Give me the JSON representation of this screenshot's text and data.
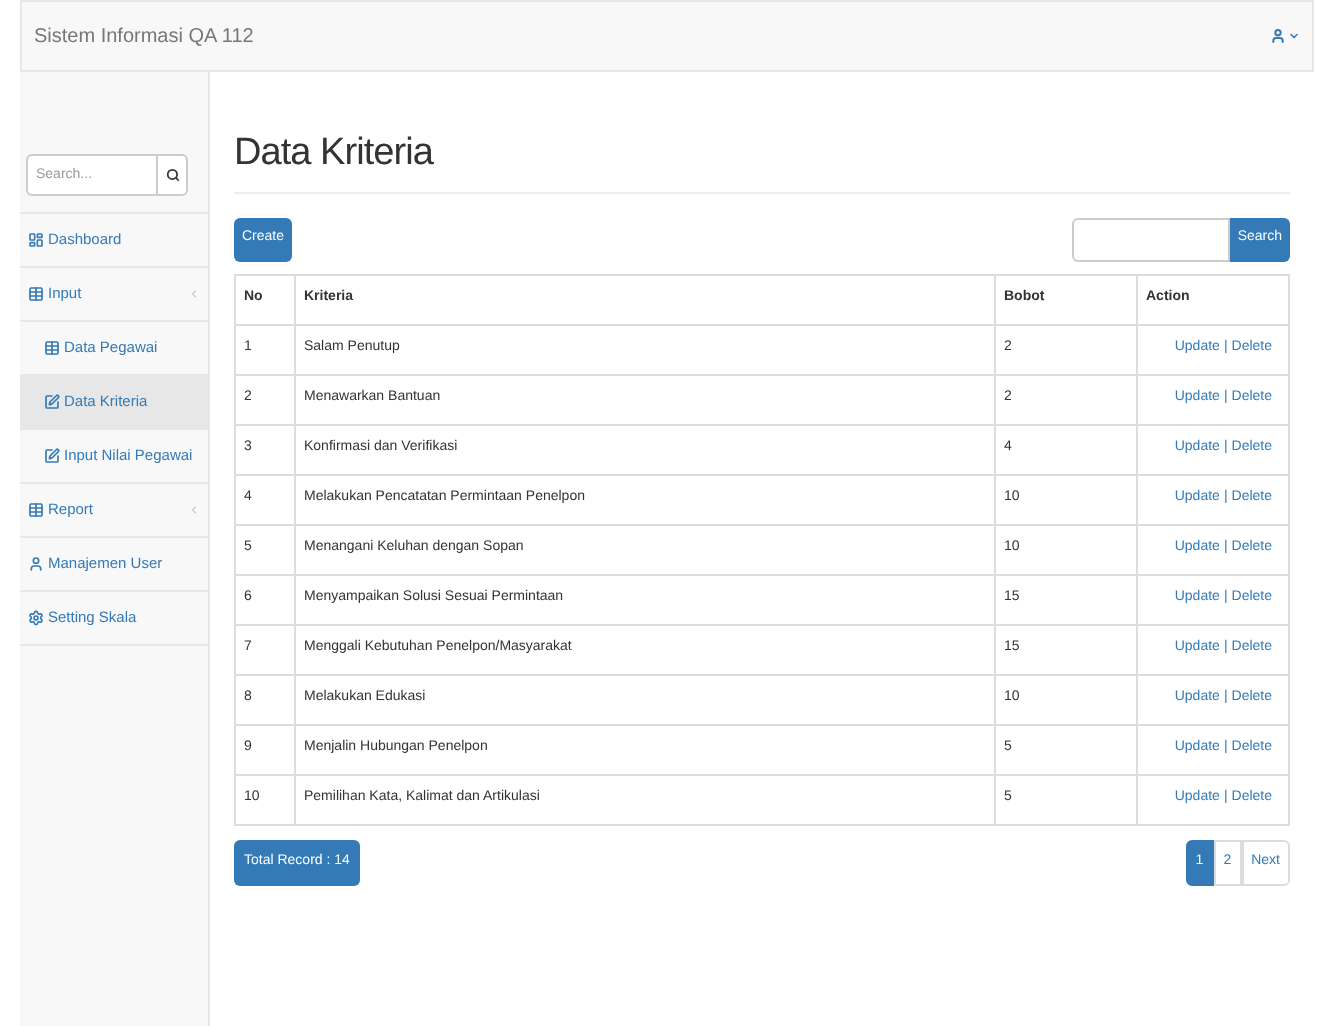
{
  "navbar": {
    "brand": "Sistem Informasi QA 112"
  },
  "sidebar": {
    "search": {
      "placeholder": "Search..."
    },
    "items": [
      {
        "label": "Dashboard",
        "kind": "dashboard",
        "selected": false,
        "submenu": false
      },
      {
        "label": "Input",
        "kind": "table",
        "selected": false,
        "submenu": true,
        "children": [
          {
            "label": "Data Pegawai",
            "kind": "table",
            "selected": false
          },
          {
            "label": "Data Kriteria",
            "kind": "edit",
            "selected": true
          },
          {
            "label": "Input Nilai Pegawai",
            "kind": "edit",
            "selected": false
          }
        ]
      },
      {
        "label": "Report",
        "kind": "table",
        "selected": false,
        "submenu": true
      },
      {
        "label": "Manajemen User",
        "kind": "user",
        "selected": false,
        "submenu": false
      },
      {
        "label": "Setting Skala",
        "kind": "gear",
        "selected": false,
        "submenu": false
      }
    ]
  },
  "page": {
    "title": "Data Kriteria",
    "create_button": "Create",
    "search_button": "Search"
  },
  "table": {
    "columns": [
      "No",
      "Kriteria",
      "Bobot",
      "Action"
    ],
    "rows": [
      {
        "no": "1",
        "kriteria": "Salam Penutup",
        "bobot": "2",
        "update": "Update",
        "separator": "|",
        "delete": "Delete"
      },
      {
        "no": "2",
        "kriteria": "Menawarkan Bantuan",
        "bobot": "2",
        "update": "Update",
        "separator": "|",
        "delete": "Delete"
      },
      {
        "no": "3",
        "kriteria": "Konfirmasi dan Verifikasi",
        "bobot": "4",
        "update": "Update",
        "separator": "|",
        "delete": "Delete"
      },
      {
        "no": "4",
        "kriteria": "Melakukan Pencatatan Permintaan Penelpon",
        "bobot": "10",
        "update": "Update",
        "separator": "|",
        "delete": "Delete"
      },
      {
        "no": "5",
        "kriteria": "Menangani Keluhan dengan Sopan",
        "bobot": "10",
        "update": "Update",
        "separator": "|",
        "delete": "Delete"
      },
      {
        "no": "6",
        "kriteria": "Menyampaikan Solusi Sesuai Permintaan",
        "bobot": "15",
        "update": "Update",
        "separator": "|",
        "delete": "Delete"
      },
      {
        "no": "7",
        "kriteria": "Menggali Kebutuhan Penelpon/Masyarakat",
        "bobot": "15",
        "update": "Update",
        "separator": "|",
        "delete": "Delete"
      },
      {
        "no": "8",
        "kriteria": "Melakukan Edukasi",
        "bobot": "10",
        "update": "Update",
        "separator": "|",
        "delete": "Delete"
      },
      {
        "no": "9",
        "kriteria": "Menjalin Hubungan Penelpon",
        "bobot": "5",
        "update": "Update",
        "separator": "|",
        "delete": "Delete"
      },
      {
        "no": "10",
        "kriteria": "Pemilihan Kata, Kalimat dan Artikulasi",
        "bobot": "5",
        "update": "Update",
        "separator": "|",
        "delete": "Delete"
      }
    ]
  },
  "total_record": "Total Record : 14",
  "pagination": [
    {
      "label": "1",
      "selected": true
    },
    {
      "label": "2",
      "selected": false
    },
    {
      "label": "Next",
      "selected": false
    }
  ]
}
